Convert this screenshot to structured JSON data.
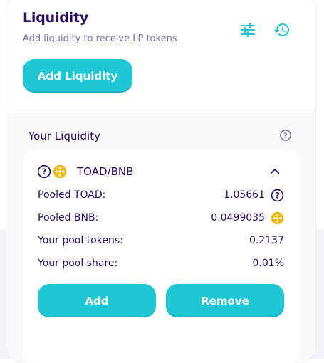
{
  "header": {
    "title": "Liquidity",
    "subtitle": "Add liquidity to receive LP tokens",
    "add_liquidity_label": "Add Liquidity",
    "icons": [
      "settings-sliders-icon",
      "history-icon"
    ]
  },
  "your_liquidity": {
    "label": "Your Liquidity",
    "pair": {
      "name": "TOAD/BNB",
      "rows": [
        {
          "label": "Pooled TOAD:",
          "value": "1.05661",
          "icon": "question-circle-icon"
        },
        {
          "label": "Pooled BNB:",
          "value": "0.0499035",
          "icon": "bnb-coin-icon"
        },
        {
          "label": "Your pool tokens:",
          "value": "0.2137"
        },
        {
          "label": "Your pool share:",
          "value": "0.01%"
        }
      ],
      "add_label": "Add",
      "remove_label": "Remove"
    }
  },
  "colors": {
    "primary": "#1fc7d4",
    "text": "#280d5f",
    "subtle": "#7a6eaa",
    "bnb": "#f0b90b"
  }
}
